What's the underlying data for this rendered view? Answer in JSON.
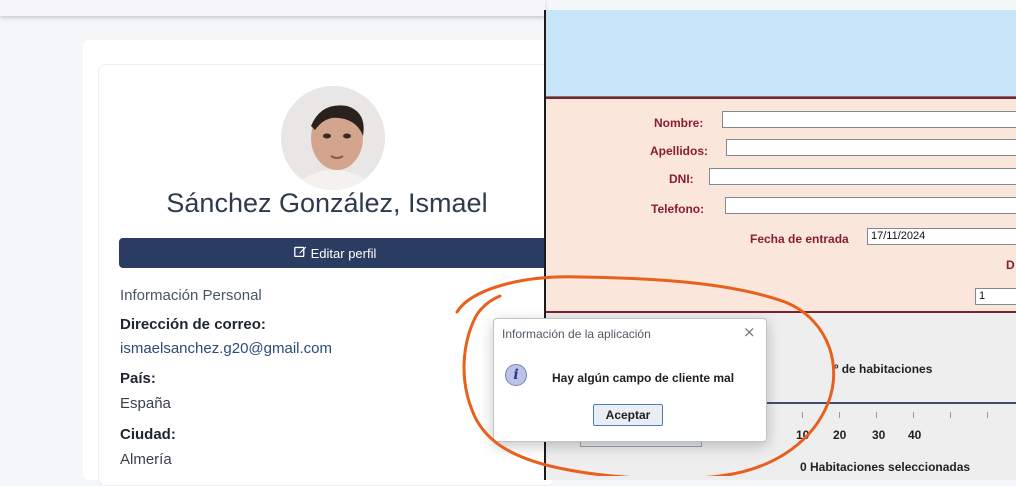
{
  "profile": {
    "name": "Sánchez González, Ismael",
    "edit_label": "Editar perfil",
    "section_title": "Información Personal",
    "email_label": "Dirección de correo:",
    "email_value": "ismaelsanchez.g20@gmail.com",
    "country_label": "País:",
    "country_value": "España",
    "city_label": "Ciudad:",
    "city_value": "Almería"
  },
  "form": {
    "nombre_label": "Nombre:",
    "apellidos_label": "Apellidos:",
    "dni_label": "DNI:",
    "telefono_label": "Telefono:",
    "nombre_value": "",
    "apellidos_value": "",
    "dni_value": "",
    "telefono_value": "",
    "fecha_label": "Fecha de entrada",
    "fecha_value": "17/11/2024",
    "partial_label": "D",
    "spinner_value": "1"
  },
  "rooms": {
    "count_label": "º de habitaciones",
    "ticks": [
      "10",
      "20",
      "30",
      "40"
    ],
    "selected_text": "0 Habitaciones seleccionadas"
  },
  "dialog": {
    "title": "Información de la aplicación",
    "close": "×",
    "icon_glyph": "i",
    "message": "Hay algún campo de cliente mal",
    "button": "Aceptar"
  },
  "colors": {
    "accent_button": "#2a3c62",
    "form_bg": "#fbe6dc",
    "form_label": "#8a1f2a",
    "top_panel": "#c7e5f8",
    "annotation": "#e8601c"
  },
  "icons": {
    "edit": "edit-icon",
    "info": "info-icon",
    "close": "close-icon"
  }
}
